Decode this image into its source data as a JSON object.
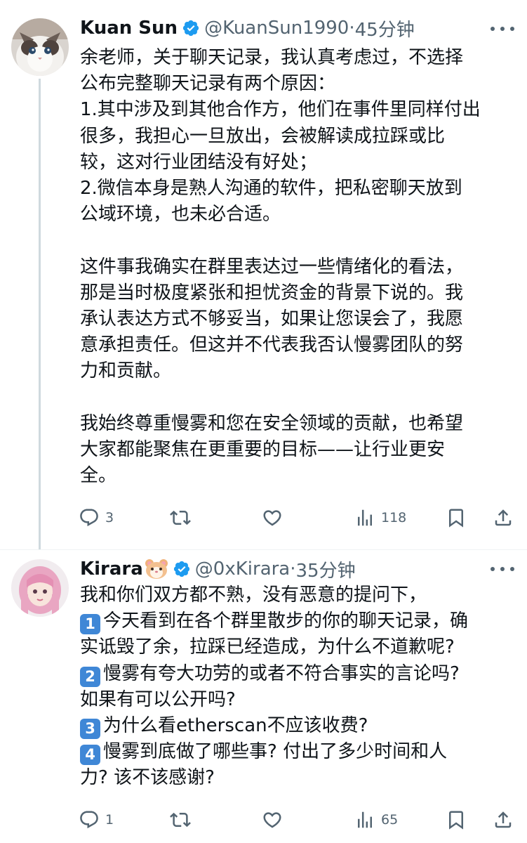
{
  "tweets": [
    {
      "name": "Kuan Sun",
      "handle": "@KuanSun1990",
      "separator": "·",
      "time": "45分钟",
      "lines": [
        "余老师，关于聊天记录，我认真考虑过，不选择",
        "公布完整聊天记录有两个原因：",
        "1.其中涉及到其他合作方，他们在事件里同样付出",
        "很多，我担心一旦放出，会被解读成拉踩或比",
        "较，这对行业团结没有好处；",
        "2.微信本身是熟人沟通的软件，把私密聊天放到",
        "公域环境，也未必合适。",
        "",
        "这件事我确实在群里表达过一些情绪化的看法，",
        "那是当时极度紧张和担忧资金的背景下说的。我",
        "承认表达方式不够妥当，如果让您误会了，我愿",
        "意承担责任。但这并不代表我否认慢雾团队的努",
        "力和贡献。",
        "",
        "我始终尊重慢雾和您在安全领域的贡献，也希望",
        "大家都能聚焦在更重要的目标——让行业更安",
        "全。"
      ],
      "replies": "3",
      "reposts": "",
      "likes": "",
      "views": "118"
    },
    {
      "name": "Kirara",
      "name_emoji": "hamster-emoji",
      "handle": "@0xKirara",
      "separator": "·",
      "time": "35分钟",
      "line1": "我和你们双方都不熟，没有恶意的提问下，",
      "items": [
        {
          "key": "1",
          "lines": [
            "今天看到在各个群里散步的你的聊天记录，确",
            "实诋毁了余，拉踩已经造成，为什么不道歉呢?"
          ]
        },
        {
          "key": "2",
          "lines": [
            "慢雾有夸大功劳的或者不符合事实的言论吗?",
            "如果有可以公开吗?"
          ]
        },
        {
          "key": "3",
          "lines": [
            "为什么看etherscan不应该收费?"
          ]
        },
        {
          "key": "4",
          "lines": [
            "慢雾到底做了哪些事? 付出了多少时间和人",
            "力? 该不该感谢?"
          ]
        }
      ],
      "replies": "1",
      "reposts": "",
      "likes": "",
      "views": "65"
    }
  ],
  "colors": {
    "text": "#0f1419",
    "secondary": "#536471",
    "verified": "#1d9bf0",
    "thread_line": "#cfd9de",
    "keycap": "#3f87d6"
  },
  "icons": [
    "reply-icon",
    "repost-icon",
    "like-icon",
    "views-icon",
    "bookmark-icon",
    "share-icon",
    "verified-badge-icon",
    "more-icon"
  ]
}
